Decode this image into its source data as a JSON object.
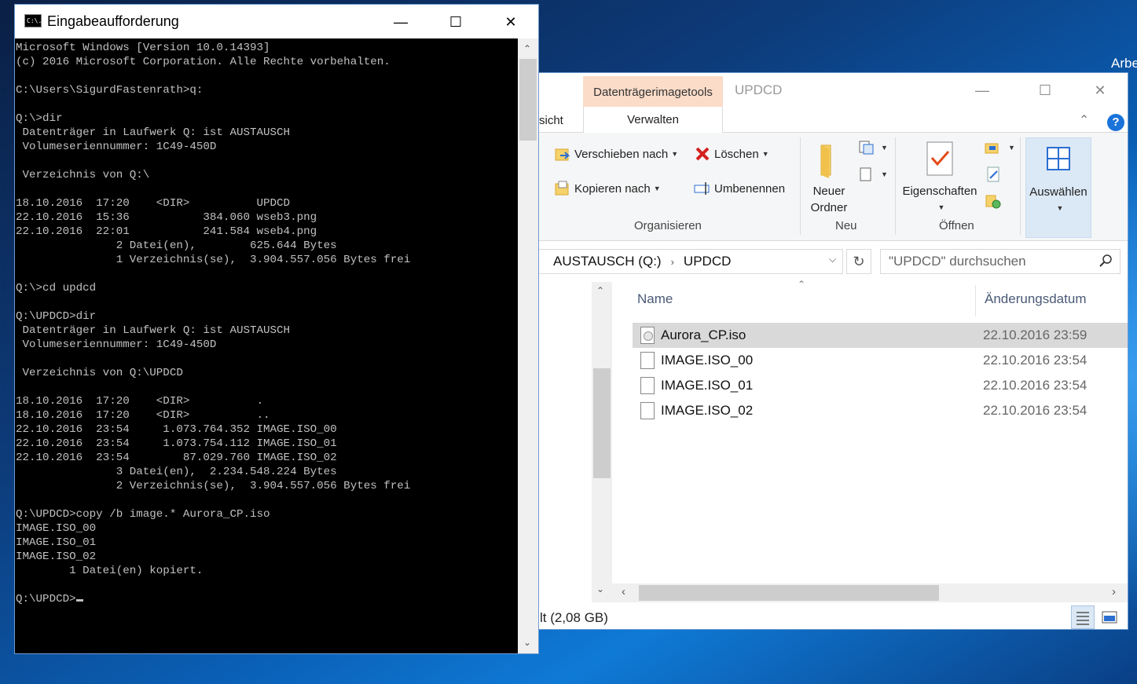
{
  "desktop": {
    "partial_label": "Arbe"
  },
  "explorer": {
    "context_tab": "Datenträgerimagetools",
    "title": "UPDCD",
    "tabs": {
      "ansicht_partial": "sicht",
      "verwalten": "Verwalten"
    },
    "ribbon": {
      "organisieren": {
        "label": "Organisieren",
        "verschieben": "Verschieben nach",
        "kopieren": "Kopieren nach",
        "loeschen": "Löschen",
        "umbenennen": "Umbenennen"
      },
      "neu": {
        "label": "Neu",
        "neuer_ordner_l1": "Neuer",
        "neuer_ordner_l2": "Ordner"
      },
      "oeffnen": {
        "label": "Öffnen",
        "eigenschaften": "Eigenschaften"
      },
      "auswaehlen": "Auswählen"
    },
    "address": {
      "drive": "AUSTAUSCH (Q:)",
      "folder": "UPDCD",
      "separator": "›"
    },
    "search_placeholder": "\"UPDCD\" durchsuchen",
    "columns": {
      "name": "Name",
      "date": "Änderungsdatum"
    },
    "files": [
      {
        "name": "Aurora_CP.iso",
        "date": "22.10.2016 23:59",
        "selected": true,
        "icon": "disc-image-file-icon"
      },
      {
        "name": "IMAGE.ISO_00",
        "date": "22.10.2016 23:54",
        "selected": false,
        "icon": "file-icon"
      },
      {
        "name": "IMAGE.ISO_01",
        "date": "22.10.2016 23:54",
        "selected": false,
        "icon": "file-icon"
      },
      {
        "name": "IMAGE.ISO_02",
        "date": "22.10.2016 23:54",
        "selected": false,
        "icon": "file-icon"
      }
    ],
    "status_partial": "lt (2,08 GB)"
  },
  "cmd": {
    "title": "Eingabeaufforderung",
    "icon_text": "C:\\.",
    "lines": [
      "Microsoft Windows [Version 10.0.14393]",
      "(c) 2016 Microsoft Corporation. Alle Rechte vorbehalten.",
      "",
      "C:\\Users\\SigurdFastenrath>q:",
      "",
      "Q:\\>dir",
      " Datenträger in Laufwerk Q: ist AUSTAUSCH",
      " Volumeseriennummer: 1C49-450D",
      "",
      " Verzeichnis von Q:\\",
      "",
      "18.10.2016  17:20    <DIR>          UPDCD",
      "22.10.2016  15:36           384.060 wseb3.png",
      "22.10.2016  22:01           241.584 wseb4.png",
      "               2 Datei(en),        625.644 Bytes",
      "               1 Verzeichnis(se),  3.904.557.056 Bytes frei",
      "",
      "Q:\\>cd updcd",
      "",
      "Q:\\UPDCD>dir",
      " Datenträger in Laufwerk Q: ist AUSTAUSCH",
      " Volumeseriennummer: 1C49-450D",
      "",
      " Verzeichnis von Q:\\UPDCD",
      "",
      "18.10.2016  17:20    <DIR>          .",
      "18.10.2016  17:20    <DIR>          ..",
      "22.10.2016  23:54     1.073.764.352 IMAGE.ISO_00",
      "22.10.2016  23:54     1.073.754.112 IMAGE.ISO_01",
      "22.10.2016  23:54        87.029.760 IMAGE.ISO_02",
      "               3 Datei(en),  2.234.548.224 Bytes",
      "               2 Verzeichnis(se),  3.904.557.056 Bytes frei",
      "",
      "Q:\\UPDCD>copy /b image.* Aurora_CP.iso",
      "IMAGE.ISO_00",
      "IMAGE.ISO_01",
      "IMAGE.ISO_02",
      "        1 Datei(en) kopiert.",
      "",
      "Q:\\UPDCD>"
    ]
  }
}
